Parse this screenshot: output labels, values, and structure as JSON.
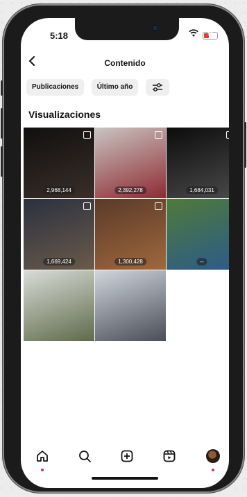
{
  "status_bar": {
    "time": "5:18",
    "battery": "10"
  },
  "header": {
    "title": "Contenido",
    "back_icon": "chevron-left-icon"
  },
  "filters": [
    {
      "label": "Publicaciones"
    },
    {
      "label": "Último año"
    }
  ],
  "filter_icon": "sliders-icon",
  "section_title": "Visualizaciones",
  "posts": [
    {
      "views": "2,968,144",
      "multi": true,
      "colors": [
        "#101010",
        "#3a2e28"
      ]
    },
    {
      "views": "2,392,278",
      "multi": true,
      "colors": [
        "#c9c4c0",
        "#8e2a33"
      ]
    },
    {
      "views": "1,684,031",
      "multi": true,
      "colors": [
        "#0c0c0c",
        "#4a4a4a"
      ]
    },
    {
      "views": "1,669,424",
      "multi": true,
      "colors": [
        "#2b3140",
        "#6a5a4a"
      ]
    },
    {
      "views": "1,300,428",
      "multi": true,
      "colors": [
        "#5a3a2a",
        "#a0683c"
      ]
    },
    {
      "views": "--",
      "multi": false,
      "colors": [
        "#4f7a3a",
        "#2c5a8a"
      ]
    },
    {
      "views": "",
      "multi": false,
      "colors": [
        "#d9dcd8",
        "#5f6a4a"
      ]
    },
    {
      "views": "",
      "multi": false,
      "colors": [
        "#cfd6de",
        "#4a4e56"
      ]
    }
  ],
  "nav": [
    {
      "icon": "home-icon",
      "active_dot": true
    },
    {
      "icon": "search-icon",
      "active_dot": false
    },
    {
      "icon": "create-icon",
      "active_dot": false
    },
    {
      "icon": "reels-icon",
      "active_dot": false
    },
    {
      "icon": "profile-avatar",
      "active_dot": true
    }
  ]
}
